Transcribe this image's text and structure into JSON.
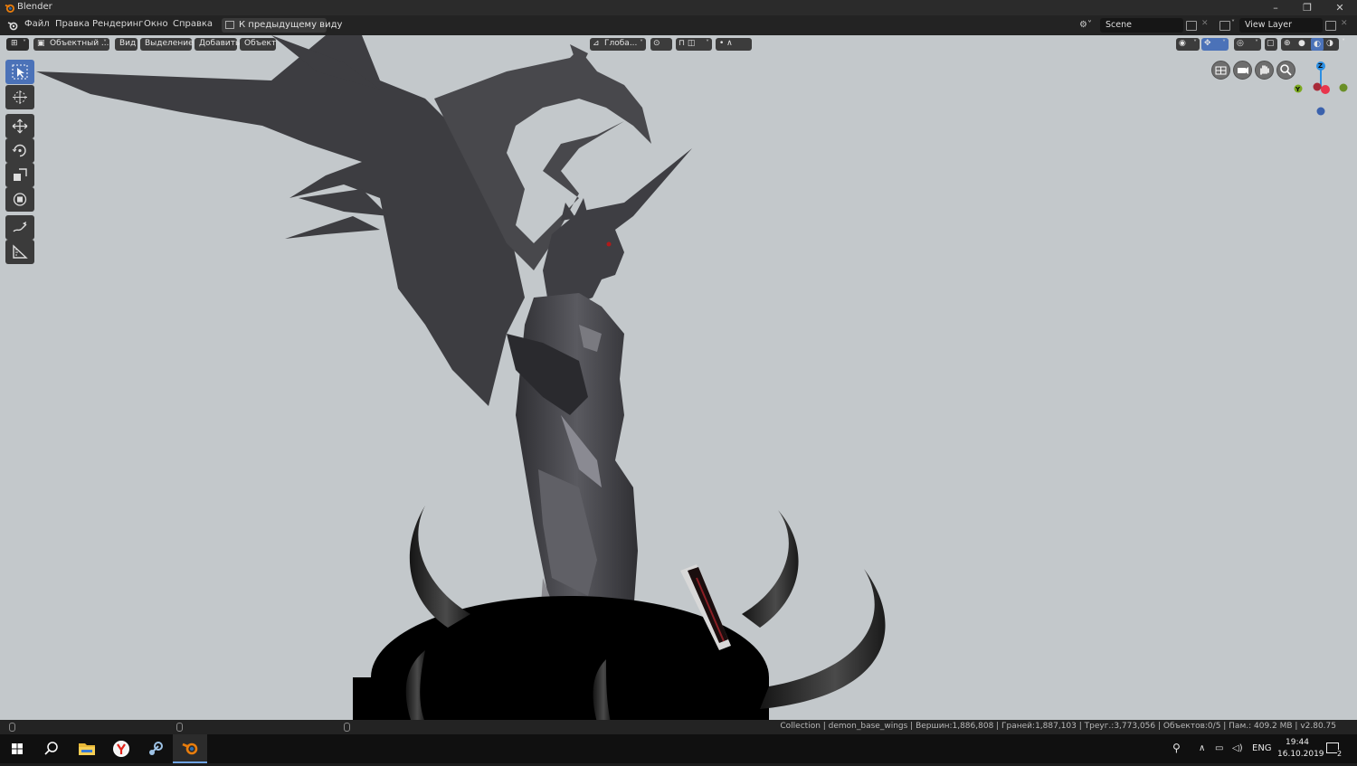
{
  "window": {
    "title": "Blender",
    "controls": {
      "minimize": "–",
      "restore": "❐",
      "close": "✕"
    }
  },
  "topbar": {
    "menus": [
      "Файл",
      "Правка",
      "Рендеринг",
      "Окно",
      "Справка"
    ],
    "back_button": "К предыдущему виду",
    "scene_name": "Scene",
    "view_layer": "View Layer"
  },
  "viewport_header": {
    "mode": "Объектный ...",
    "menus": [
      "Вид",
      "Выделение",
      "Добавить",
      "Объект"
    ],
    "orientation": "Глоба..."
  },
  "toolbar": {
    "tools": [
      "select-box",
      "cursor",
      "move",
      "rotate",
      "scale",
      "transform",
      "annotate",
      "measure"
    ],
    "active_tool": "select-box"
  },
  "gizmo": {
    "axes": {
      "z": "Z",
      "y": "Y"
    },
    "colors": {
      "x": "#e8354c",
      "y": "#7ba91e",
      "z": "#2c8fe3",
      "neg_z": "#3b62ad"
    }
  },
  "statusbar": {
    "stats": "Collection | demon_base_wings | Вершин:1,886,808 | Граней:1,887,103 | Треуг.:3,773,056 | Объектов:0/5 | Пам.: 409.2 MB | v2.80.75"
  },
  "taskbar": {
    "language": "ENG",
    "time": "19:44",
    "date": "16.10.2019",
    "notifications": "2"
  },
  "colors": {
    "viewport_bg": "#c3c8cb",
    "accent": "#4b72b8",
    "model": "#3a3a3e"
  }
}
